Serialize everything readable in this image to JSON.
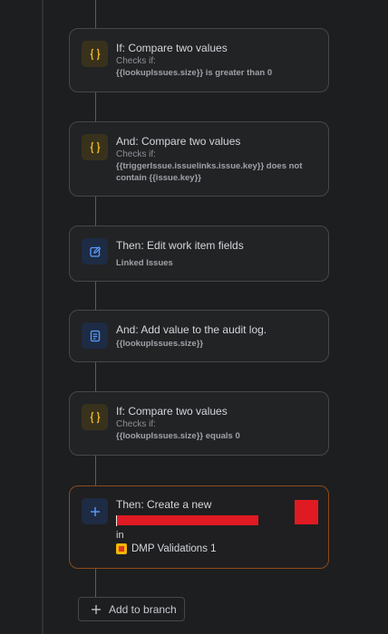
{
  "steps": [
    {
      "title": "If: Compare two values",
      "subtitle": "Checks if:",
      "detail": "{{lookupIssues.size}} is greater than 0",
      "icon": "braces-icon"
    },
    {
      "title": "And: Compare two values",
      "subtitle": "Checks if:",
      "detail": "{{triggerIssue.issuelinks.issue.key}} does not contain {{issue.key}}",
      "icon": "braces-icon"
    },
    {
      "title": "Then: Edit work item fields",
      "detail": "Linked Issues",
      "icon": "edit-icon"
    },
    {
      "title": "And: Add value to the audit log.",
      "detail": "{{lookupIssues.size}}",
      "icon": "log-icon"
    },
    {
      "title": "If: Compare two values",
      "subtitle": "Checks if:",
      "detail": "{{lookupIssues.size}} equals 0",
      "icon": "braces-icon"
    },
    {
      "title": "Then: Create a new",
      "in_label": "in",
      "project": "DMP Validations 1",
      "icon": "plus-icon"
    }
  ],
  "add_branch_label": "Add to branch",
  "colors": {
    "condition_icon": "#e6b422",
    "action_icon": "#579dff",
    "selected_border": "#8a4a1c",
    "redaction": "#e01a22"
  }
}
